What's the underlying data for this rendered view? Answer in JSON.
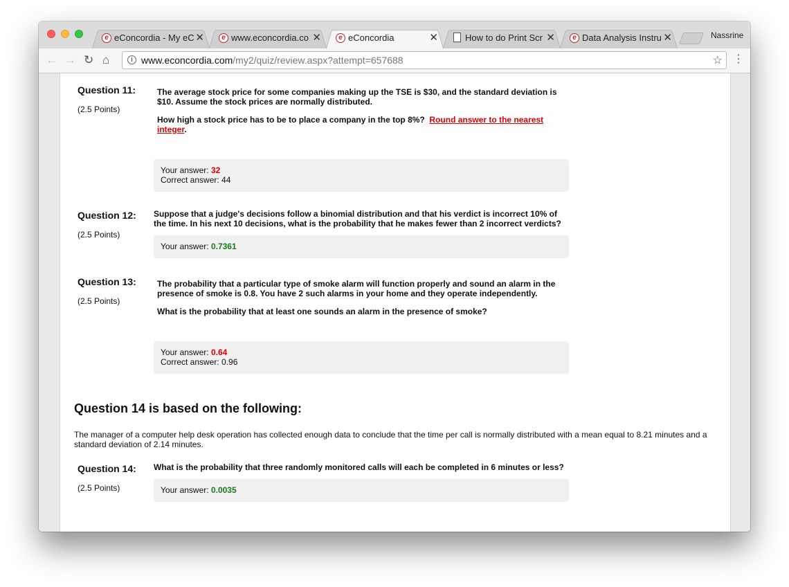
{
  "browser": {
    "tabs": [
      {
        "label": "eConcordia - My eC",
        "icon": "econcordia-favicon",
        "active": false
      },
      {
        "label": "www.econcordia.co",
        "icon": "econcordia-favicon",
        "active": false
      },
      {
        "label": "eConcordia",
        "icon": "econcordia-favicon",
        "active": true
      },
      {
        "label": "How to do Print Scr",
        "icon": "document-icon",
        "active": false
      },
      {
        "label": "Data Analysis Instru",
        "icon": "econcordia-favicon",
        "active": false
      }
    ],
    "profile_name": "Nassrine",
    "url_host": "www.econcordia.com",
    "url_path": "/my2/quiz/review.aspx?attempt=657688",
    "favicon_letter": "e"
  },
  "questions": [
    {
      "label": "Question 11:",
      "points": "(2.5 Points)",
      "text": "The average stock price for some companies making up the TSE is $30, and the standard deviation is $10. Assume the stock prices are normally distributed.",
      "text2": "How high a stock price has to be to place a company in the top 8%?",
      "instruction": "Round answer to the nearest integer",
      "your_answer_label": "Your answer:",
      "your_answer": "32",
      "correct_answer": "Correct answer: 44"
    },
    {
      "label": "Question 12:",
      "points": "(2.5 Points)",
      "text": "Suppose that a judge's decisions follow a binomial distribution and that his verdict is incorrect 10% of the time. In his next 10 decisions, what is the probability that he makes fewer than 2 incorrect verdicts?",
      "your_answer_label": "Your answer:",
      "your_answer": "0.7361"
    },
    {
      "label": "Question 13:",
      "points": "(2.5 Points)",
      "text": "The probability that a particular type of smoke alarm will function properly and sound an alarm in the presence of smoke is 0.8. You have 2 such alarms in your home and they operate independently.",
      "text2": "What is the probability that at least one sounds an alarm in the presence of smoke?",
      "your_answer_label": "Your answer:",
      "your_answer": "0.64",
      "correct_answer": "Correct answer: 0.96"
    },
    {
      "label": "Question 14:",
      "points": "(2.5 Points)",
      "text": "What is the probability that three randomly monitored calls will each be completed in 6 minutes or less?",
      "your_answer_label": "Your answer:",
      "your_answer": "0.0035"
    }
  ],
  "section": {
    "heading": "Question 14 is based on the following:",
    "scenario": "The manager of a computer help desk operation has collected enough data to conclude that the time per call is normally distributed with a mean equal to 8.21 minutes and a standard deviation of 2.14 minutes."
  },
  "colors": {
    "wrong_answer": "#e00000",
    "correct_answer": "#1a7a1a",
    "answer_box_bg": "#f0f0f0"
  }
}
